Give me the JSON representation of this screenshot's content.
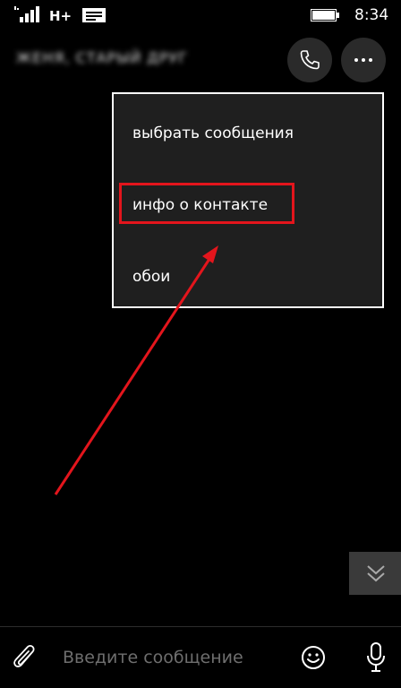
{
  "status_bar": {
    "network": "H+",
    "time": "8:34",
    "icons": [
      "signal-icon",
      "message-notification-icon",
      "battery-icon"
    ]
  },
  "header": {
    "contact_name": "ЖЕНЯ, СТАРЫЙ ДРУГ",
    "actions": [
      "phone-icon",
      "more-options-icon"
    ]
  },
  "context_menu": {
    "items": [
      {
        "label": "выбрать сообщения"
      },
      {
        "label": "инфо о контакте",
        "highlighted": true
      },
      {
        "label": "обои"
      }
    ]
  },
  "annotation": {
    "highlight_color": "#e3151c",
    "arrow_color": "#e3151c"
  },
  "compose": {
    "placeholder": "Введите сообщение",
    "value": "",
    "icons": [
      "paperclip-icon",
      "emoji-icon",
      "microphone-icon"
    ]
  },
  "colors": {
    "background": "#000000",
    "menu_background": "#1f1f1f",
    "menu_border": "#ffffff",
    "button_background": "#2a2a2a"
  }
}
